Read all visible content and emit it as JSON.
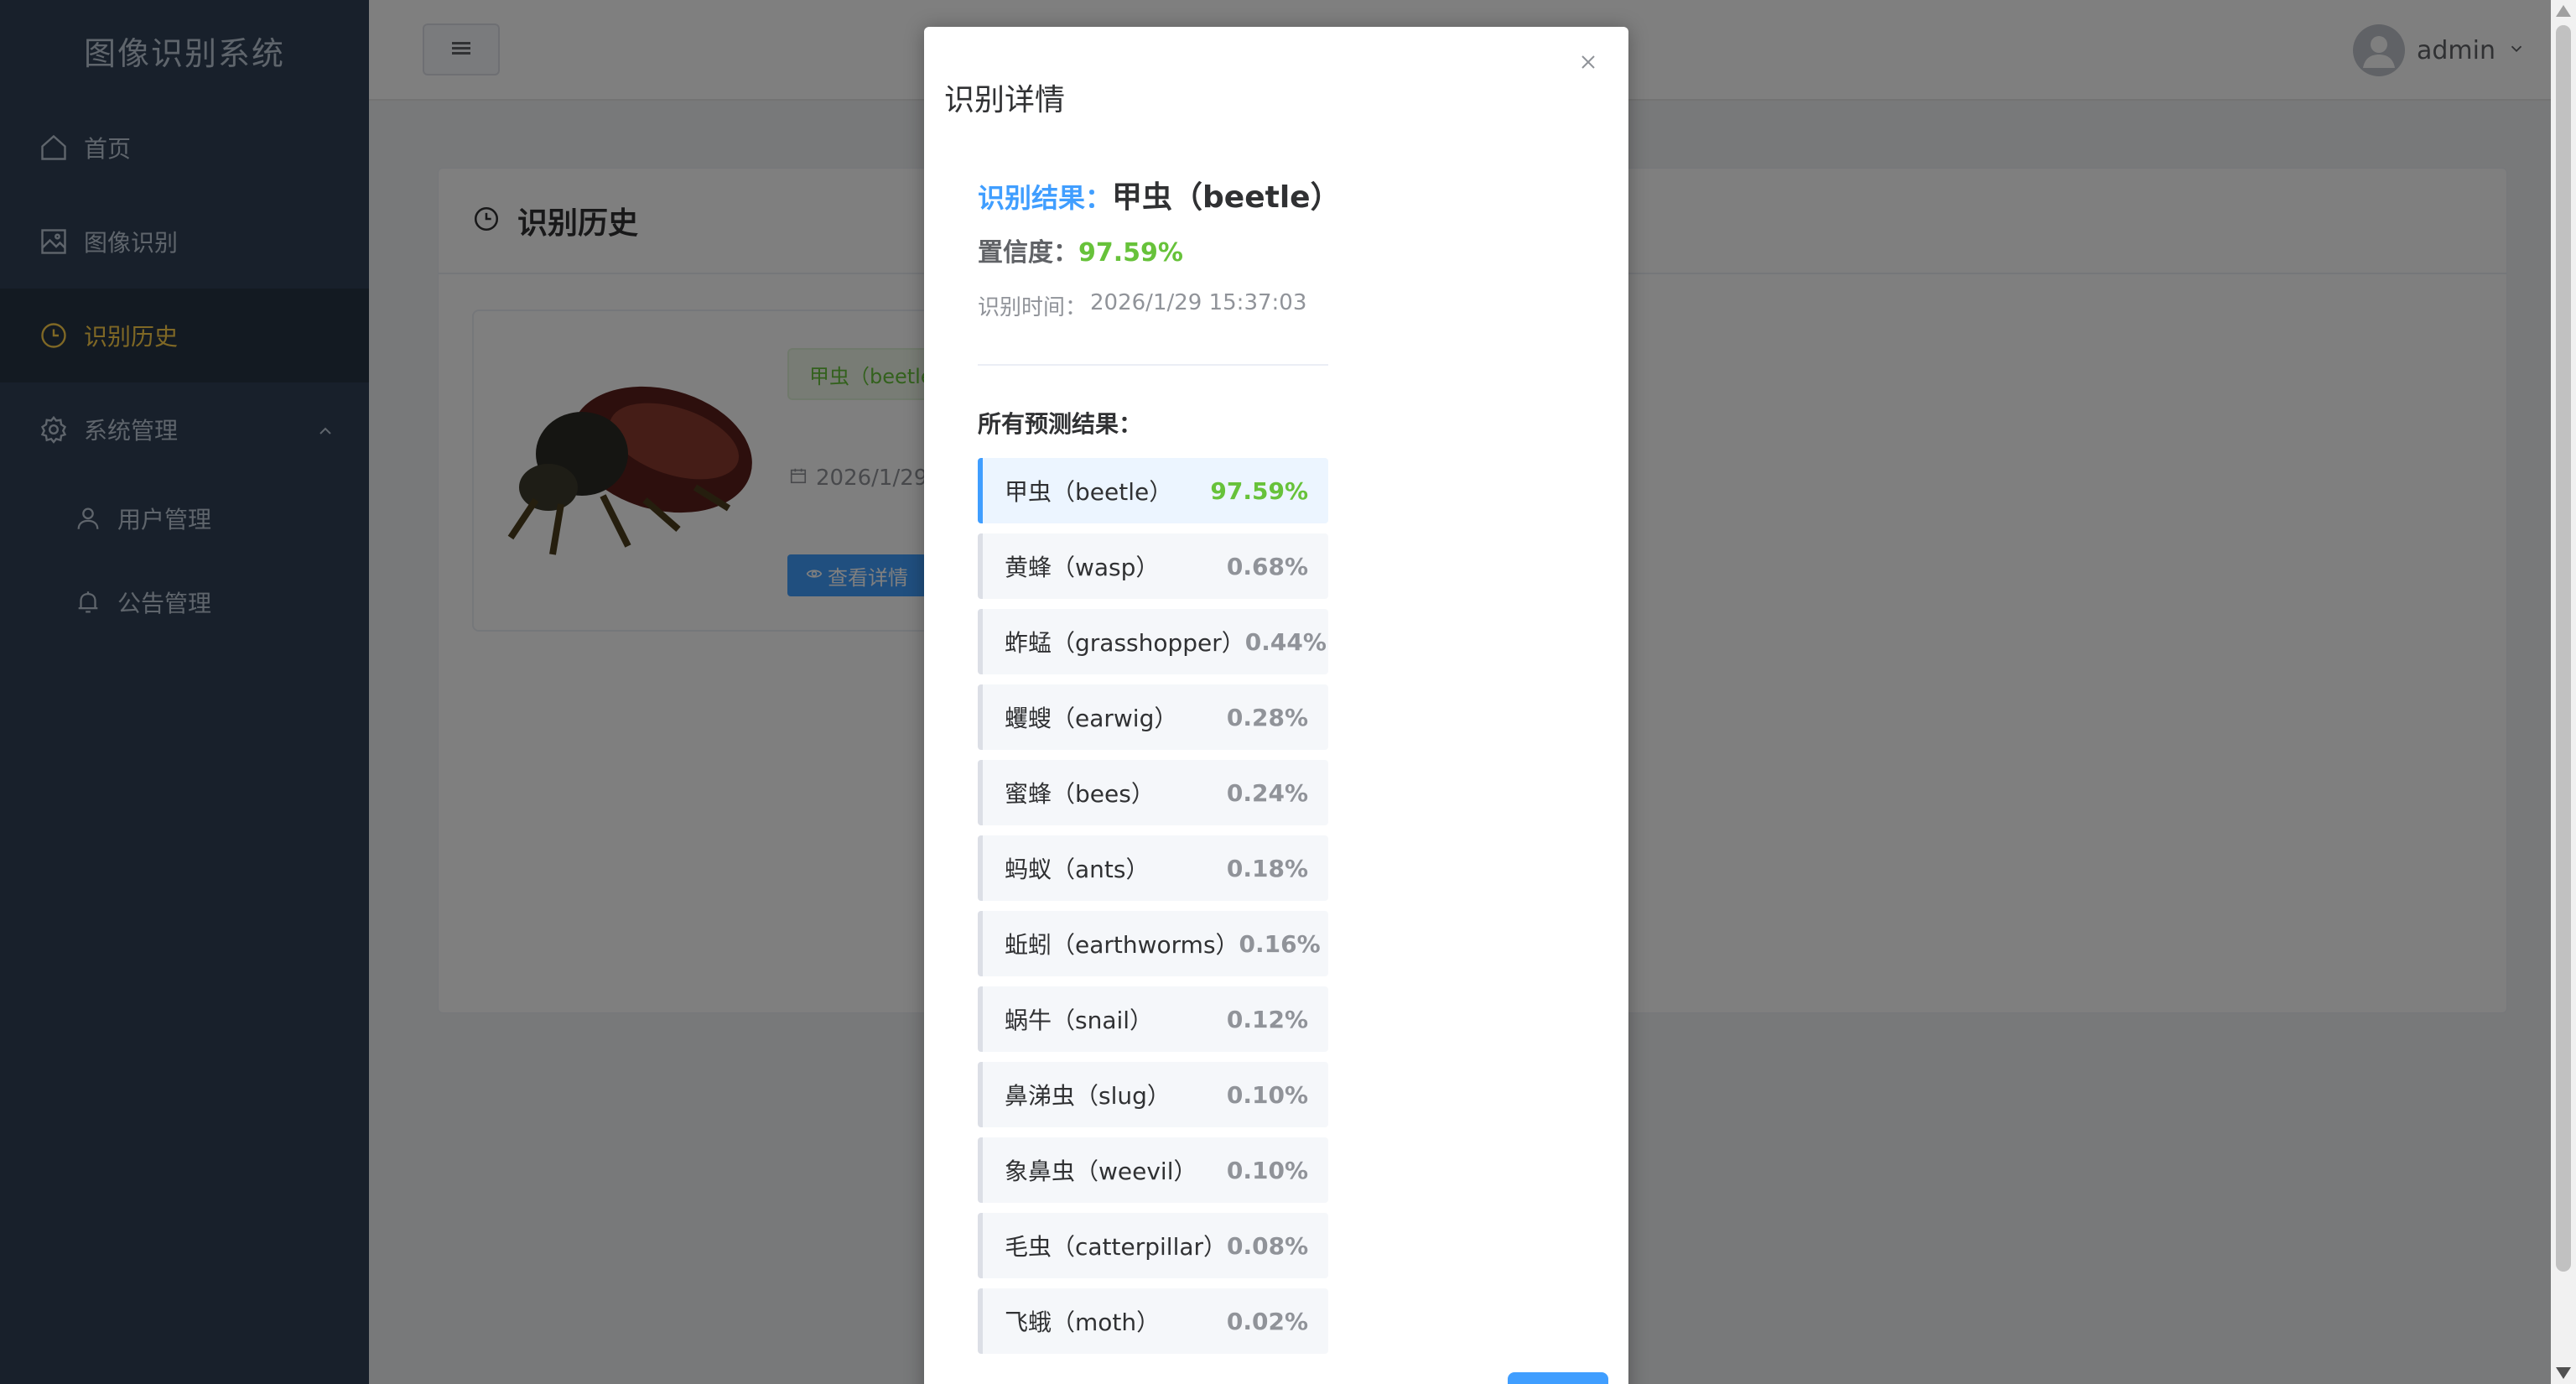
{
  "app": {
    "title": "图像识别系统"
  },
  "sidebar": {
    "items": [
      {
        "label": "首页",
        "icon": "home-icon"
      },
      {
        "label": "图像识别",
        "icon": "picture-icon"
      },
      {
        "label": "识别历史",
        "icon": "clock-icon",
        "active": true
      },
      {
        "label": "系统管理",
        "icon": "gear-icon",
        "expanded": true
      }
    ],
    "subitems": [
      {
        "label": "用户管理",
        "icon": "user-icon"
      },
      {
        "label": "公告管理",
        "icon": "bell-icon"
      }
    ]
  },
  "header": {
    "user": "admin"
  },
  "card": {
    "title": "识别历史",
    "item": {
      "tag": "甲虫（beetle）",
      "date": "2026/1/29 15:37:03",
      "button": "查看详情"
    }
  },
  "dialog": {
    "title": "识别详情",
    "result_label": "识别结果：",
    "result_value": "甲虫（beetle）",
    "confidence_label": "置信度：",
    "confidence_value": "97.59%",
    "time_label": "识别时间：",
    "time_value": "2026/1/29 15:37:03",
    "all_title": "所有预测结果：",
    "predictions": [
      {
        "name": "甲虫（beetle）",
        "prob": "97.59%"
      },
      {
        "name": "黄蜂（wasp）",
        "prob": "0.68%"
      },
      {
        "name": "蚱蜢（grasshopper）",
        "prob": "0.44%"
      },
      {
        "name": "蠼螋（earwig）",
        "prob": "0.28%"
      },
      {
        "name": "蜜蜂（bees）",
        "prob": "0.24%"
      },
      {
        "name": "蚂蚁（ants）",
        "prob": "0.18%"
      },
      {
        "name": "蚯蚓（earthworms）",
        "prob": "0.16%"
      },
      {
        "name": "蜗牛（snail）",
        "prob": "0.12%"
      },
      {
        "name": "鼻涕虫（slug）",
        "prob": "0.10%"
      },
      {
        "name": "象鼻虫（weevil）",
        "prob": "0.10%"
      },
      {
        "name": "毛虫（catterpillar）",
        "prob": "0.08%"
      },
      {
        "name": "飞蛾（moth）",
        "prob": "0.02%"
      }
    ]
  },
  "colors": {
    "sidebar_bg": "#304156",
    "active_text": "#ffd04b",
    "primary": "#409eff",
    "success": "#67c23a"
  }
}
